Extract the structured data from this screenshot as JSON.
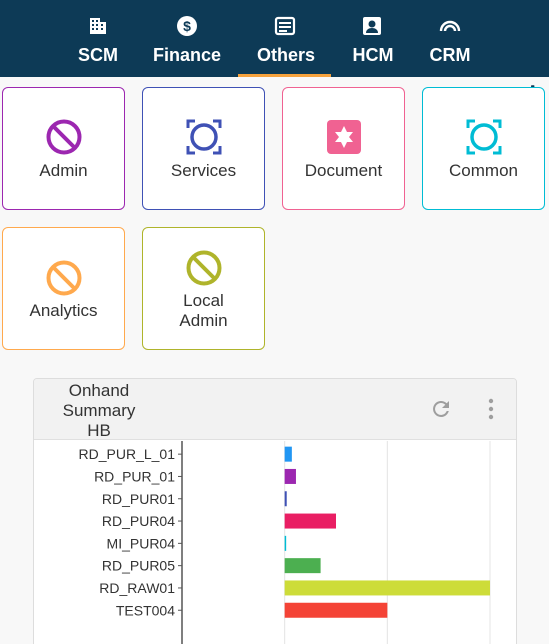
{
  "nav": {
    "tabs": [
      {
        "label": "SCM",
        "icon": "building-icon",
        "active": false
      },
      {
        "label": "Finance",
        "icon": "dollar-icon",
        "active": false
      },
      {
        "label": "Others",
        "icon": "list-box-icon",
        "active": true
      },
      {
        "label": "HCM",
        "icon": "person-card-icon",
        "active": false
      },
      {
        "label": "CRM",
        "icon": "wifi-arc-icon",
        "active": false
      }
    ]
  },
  "tiles": [
    {
      "label": "Admin",
      "icon": "prohibit-icon",
      "color": "#9c27b0"
    },
    {
      "label": "Services",
      "icon": "ring-brackets-icon",
      "color": "#3f51b5"
    },
    {
      "label": "Document",
      "icon": "puzzle-box-icon",
      "color": "#f06292"
    },
    {
      "label": "Common",
      "icon": "ring-brackets-icon",
      "color": "#00bcd4"
    },
    {
      "label": "Analytics",
      "icon": "prohibit-icon",
      "color": "#ffa94d"
    },
    {
      "label": "Local\nAdmin",
      "icon": "prohibit-icon",
      "color": "#afb42b"
    }
  ],
  "settings_icon": "gear-icon",
  "widget": {
    "title": "Onhand Summary HB",
    "refresh_icon": "refresh-icon",
    "menu_icon": "more-vert-icon"
  },
  "chart_data": {
    "type": "bar",
    "orientation": "horizontal",
    "categories": [
      "RD_PUR_L_01",
      "RD_PUR_01",
      "RD_PUR01",
      "RD_PUR04",
      "MI_PUR04",
      "RD_PUR05",
      "RD_RAW01",
      "TEST004"
    ],
    "values": [
      0.07,
      0.11,
      0.02,
      0.5,
      0.01,
      0.35,
      2.0,
      1.0
    ],
    "colors": [
      "#2196f3",
      "#9c27b0",
      "#3f51b5",
      "#e91e63",
      "#00bcd4",
      "#4caf50",
      "#cddc39",
      "#f44336"
    ],
    "xlim": [
      -1,
      2
    ],
    "grid": true
  }
}
